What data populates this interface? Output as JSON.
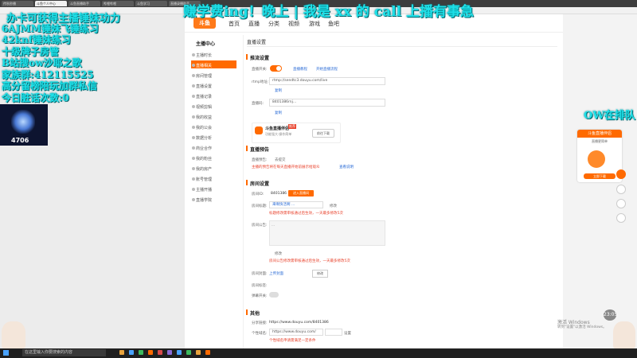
{
  "browser": {
    "tabs": [
      "传秋秒播",
      "斗鱼个人中心",
      "斗鱼直播助手",
      "哔哩哔哩",
      "斗鱼学习",
      "直播录播助手"
    ],
    "active_tab": 1
  },
  "header": {
    "logo": "斗鱼",
    "nav": [
      "首页",
      "直播",
      "分类",
      "视频",
      "游戏",
      "鱼吧"
    ]
  },
  "sidebar": {
    "title": "主播中心",
    "items": [
      "主播时长",
      "直播相关",
      "房间管理",
      "直播设置",
      "直播记录",
      "视频剪辑",
      "我的收益",
      "我的公会",
      "数据分析",
      "商业合作",
      "我的粉丝",
      "我的房产",
      "账号管理",
      "主播开播",
      "直播学院"
    ]
  },
  "main": {
    "page_title": "直播设置",
    "sec1": {
      "title": "推流设置",
      "toggle_label": "直播开关:",
      "toggle_on": true,
      "link1": "直播教程",
      "link2": "开始直播流程",
      "rtmp_label": "rtmp地址:",
      "rtmp_value": "rtmp://sendtc3.douyu.com/live",
      "copy": "复制",
      "code_label": "直播码:",
      "code_value": "8401386rnj…",
      "copy2": "复制",
      "tool_name": "斗鱼直播伴侣",
      "tool_sub": "功能强大·操作简单",
      "tool_badge": "推荐",
      "tool_btn": "前往下载"
    },
    "sec2": {
      "title": "直播预告",
      "label": "直播预告:",
      "value": "去提交",
      "warn": "主播的预告将在每天直播开始前展示给观众",
      "link": "查看说明"
    },
    "sec3": {
      "title": "房间设置",
      "room_label": "房间ID:",
      "room_id": "8401386",
      "room_btn": "进入直播间",
      "name_label": "房间标题:",
      "name_value": "来啊快活啊 …",
      "name_btn": "修改",
      "name_warn": "标题修改需审核通过后生效，一天最多修改5次",
      "notice_label": "房间公告:",
      "notice_value": "…",
      "notice_btn": "修改",
      "notice_warn": "房间公告修改需审核通过后生效，一天最多修改5次",
      "cover_label": "房间封面:",
      "cover_link": "上传封面",
      "cover_btn": "修改",
      "tag_label": "房间标签:",
      "switch_label": "弹幕开关:"
    },
    "sec4": {
      "title": "其他",
      "share_label": "分享链接:",
      "share_value": "https://www.douyu.com/8401386",
      "short_label": "个性域名:",
      "short_value": "https://www.douyu.com/",
      "short_btn": "设置",
      "short_warn": "个性域名申请需满足一定条件"
    }
  },
  "overlay": {
    "top_banner": "赚学费ing！晚上 | 我是 xx 的 call 上播有事急",
    "left_lines": [
      "办卡可获得主播锤妹功力",
      "6AJMM锤妹飞锤练习",
      "42knf锤妹练习",
      "十级牌子房管",
      "B站搜ow沙耶之歌",
      "家族群:412115525",
      "高分留榜陪玩加群私信",
      "今日脏话次数:0"
    ],
    "rank_value": "4706",
    "right_text": "OW在排队"
  },
  "ad": {
    "title": "斗鱼直播伴侣",
    "sub": "直播更简单",
    "btn": "立即下载"
  },
  "watermark": {
    "line1": "激活 Windows",
    "line2": "转到\"设置\"以激活 Windows。"
  },
  "taskbar": {
    "search": "在这里输入你要搜索的内容",
    "time": "23:05"
  },
  "colors": {
    "accent": "#ff6a00",
    "overlay_text": "#1ee0e8"
  }
}
